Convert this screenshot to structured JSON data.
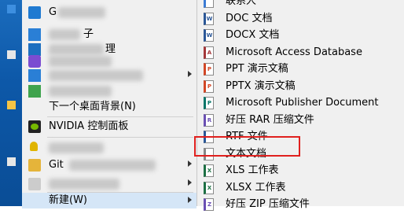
{
  "context_menu": {
    "items": [
      {
        "label": "G",
        "icon": "vs-code-icon"
      },
      {
        "label": "子",
        "icon": "blue-square-icon"
      },
      {
        "label": "理",
        "icon": "blue-square-icon"
      },
      {
        "label": "",
        "icon": "purple-cube-icon"
      },
      {
        "label": "",
        "icon": "blue-list-icon"
      },
      {
        "label": "",
        "icon": "green-square-icon"
      },
      {
        "label": "下一个桌面背景(N)",
        "icon": ""
      },
      {
        "label": "NVIDIA 控制面板",
        "icon": "nvidia-icon"
      },
      {
        "label": "",
        "icon": "key-icon"
      },
      {
        "label": "Git",
        "icon": "stack-icon"
      },
      {
        "label": "",
        "icon": "folder-icon"
      },
      {
        "label": "新建(W)",
        "icon": ""
      }
    ]
  },
  "new_submenu": {
    "items": [
      {
        "label": "联系人",
        "icon": "contact-file-icon",
        "icon_text": "",
        "color": "#3b7bd4"
      },
      {
        "label": "DOC 文档",
        "icon": "word-doc-icon",
        "icon_text": "W",
        "color": "#2b5797"
      },
      {
        "label": "DOCX 文档",
        "icon": "word-docx-icon",
        "icon_text": "W",
        "color": "#2b5797"
      },
      {
        "label": "Microsoft Access Database",
        "icon": "access-icon",
        "icon_text": "A",
        "color": "#a4373a"
      },
      {
        "label": "PPT 演示文稿",
        "icon": "ppt-icon",
        "icon_text": "P",
        "color": "#d24726"
      },
      {
        "label": "PPTX 演示文稿",
        "icon": "pptx-icon",
        "icon_text": "P",
        "color": "#d24726"
      },
      {
        "label": "Microsoft Publisher Document",
        "icon": "publisher-icon",
        "icon_text": "P",
        "color": "#077568"
      },
      {
        "label": "好压 RAR 压缩文件",
        "icon": "rar-archive-icon",
        "icon_text": "R",
        "color": "#6a4fb3"
      },
      {
        "label": "RTF 文件",
        "icon": "rtf-file-icon",
        "icon_text": "",
        "color": "#2b5797"
      },
      {
        "label": "文本文档",
        "icon": "text-document-icon",
        "icon_text": "",
        "color": "#888888"
      },
      {
        "label": "XLS 工作表",
        "icon": "xls-icon",
        "icon_text": "X",
        "color": "#1d7044"
      },
      {
        "label": "XLSX 工作表",
        "icon": "xlsx-icon",
        "icon_text": "X",
        "color": "#1d7044"
      },
      {
        "label": "好压 ZIP 压缩文件",
        "icon": "zip-archive-icon",
        "icon_text": "Z",
        "color": "#6a4fb3"
      }
    ]
  },
  "colors": {
    "menu_bg": "#f0f0f0",
    "hover_bg": "#d5e6f7",
    "highlight_border": "#e0201e",
    "desktop": "#0d58a8"
  }
}
